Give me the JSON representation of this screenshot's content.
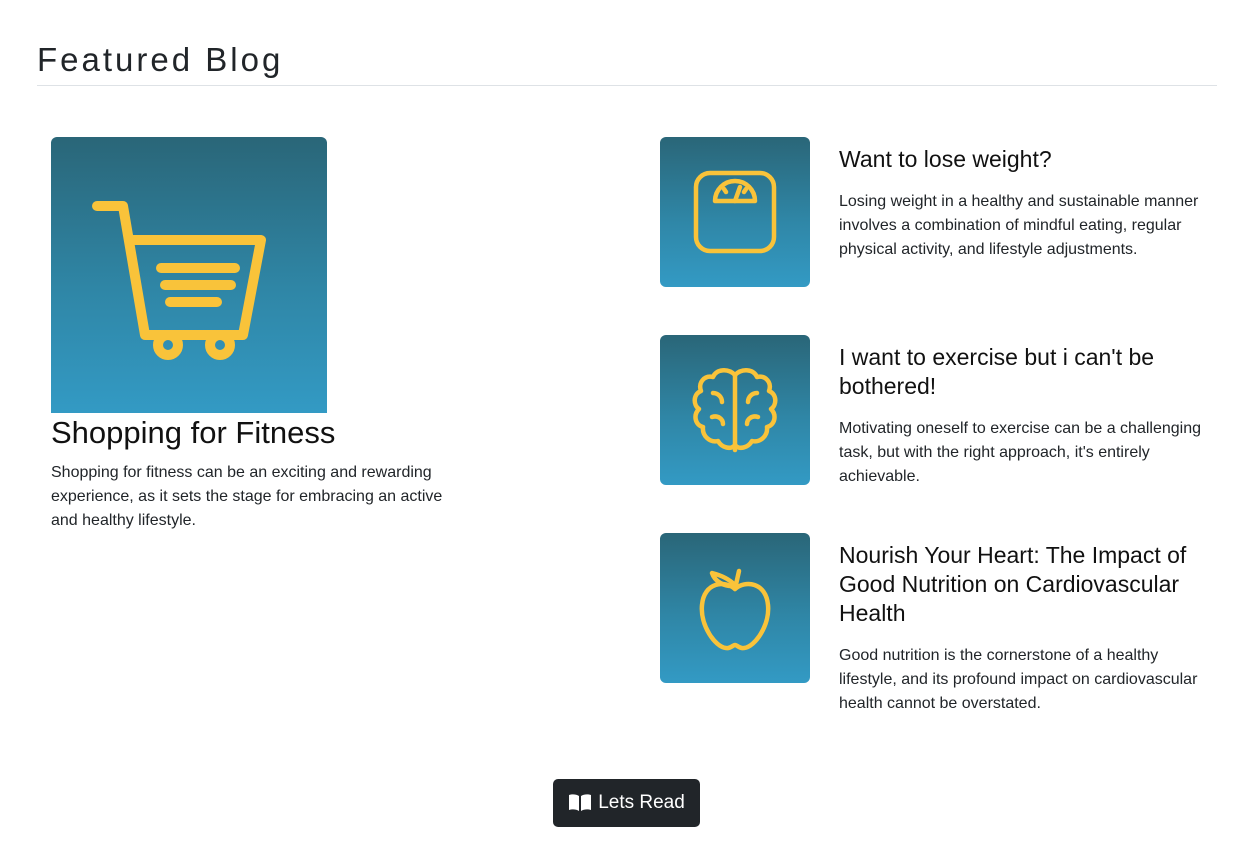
{
  "section": {
    "title": "Featured Blog"
  },
  "featured": {
    "icon": "shopping-cart-icon",
    "heading": "Shopping for Fitness",
    "text": "Shopping for fitness can be an exciting and rewarding experience, as it sets the stage for embracing an active and healthy lifestyle."
  },
  "posts": [
    {
      "icon": "scale-icon",
      "heading": "Want to lose weight?",
      "text": "Losing weight in a healthy and sustainable manner involves a combination of mindful eating, regular physical activity, and lifestyle adjustments."
    },
    {
      "icon": "brain-icon",
      "heading": "I want to exercise but i can't be bothered!",
      "text": "Motivating oneself to exercise can be a challenging task, but with the right approach, it's entirely achievable."
    },
    {
      "icon": "apple-icon",
      "heading": "Nourish Your Heart: The Impact of Good Nutrition on Cardiovascular Health",
      "text": "Good nutrition is the cornerstone of a healthy lifestyle, and its profound impact on cardiovascular health cannot be overstated."
    }
  ],
  "button": {
    "icon": "book-open-icon",
    "label": "Lets Read"
  },
  "colors": {
    "icon_accent": "#f9c33a",
    "thumb_top": "#2a6678",
    "thumb_bottom": "#339ac4",
    "button_bg": "#212529"
  }
}
